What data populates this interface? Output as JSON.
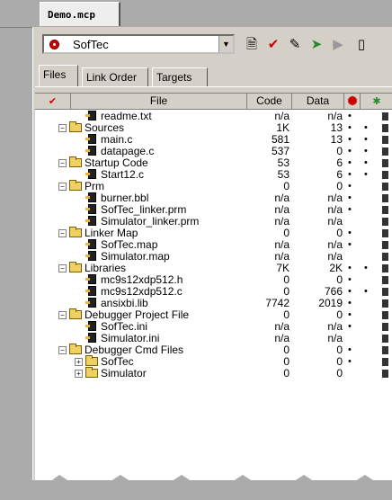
{
  "tab": {
    "label": "Demo.mcp"
  },
  "target": {
    "selected": "SofTec"
  },
  "subtabs": [
    "Files",
    "Link Order",
    "Targets"
  ],
  "columns": {
    "file": "File",
    "code": "Code",
    "data": "Data"
  },
  "rows": [
    {
      "name": "readme.txt",
      "code": "n/a",
      "data": "n/a",
      "depth": 1,
      "icon": "file",
      "b1": "•",
      "b2": ""
    },
    {
      "name": "Sources",
      "code": "1K",
      "data": "13",
      "depth": 0,
      "icon": "folder",
      "b1": "•",
      "b2": "•"
    },
    {
      "name": "main.c",
      "code": "581",
      "data": "13",
      "depth": 1,
      "icon": "file",
      "b1": "•",
      "b2": "•"
    },
    {
      "name": "datapage.c",
      "code": "537",
      "data": "0",
      "depth": 1,
      "icon": "file",
      "b1": "•",
      "b2": "•"
    },
    {
      "name": "Startup Code",
      "code": "53",
      "data": "6",
      "depth": 0,
      "icon": "folder",
      "b1": "•",
      "b2": "•"
    },
    {
      "name": "Start12.c",
      "code": "53",
      "data": "6",
      "depth": 1,
      "icon": "file",
      "b1": "•",
      "b2": "•"
    },
    {
      "name": "Prm",
      "code": "0",
      "data": "0",
      "depth": 0,
      "icon": "folder",
      "b1": "•",
      "b2": ""
    },
    {
      "name": "burner.bbl",
      "code": "n/a",
      "data": "n/a",
      "depth": 1,
      "icon": "file",
      "b1": "•",
      "b2": ""
    },
    {
      "name": "SofTec_linker.prm",
      "code": "n/a",
      "data": "n/a",
      "depth": 1,
      "icon": "file",
      "b1": "•",
      "b2": ""
    },
    {
      "name": "Simulator_linker.prm",
      "code": "n/a",
      "data": "n/a",
      "depth": 1,
      "icon": "file",
      "b1": "",
      "b2": ""
    },
    {
      "name": "Linker Map",
      "code": "0",
      "data": "0",
      "depth": 0,
      "icon": "folder",
      "b1": "•",
      "b2": ""
    },
    {
      "name": "SofTec.map",
      "code": "n/a",
      "data": "n/a",
      "depth": 1,
      "icon": "file",
      "b1": "•",
      "b2": ""
    },
    {
      "name": "Simulator.map",
      "code": "n/a",
      "data": "n/a",
      "depth": 1,
      "icon": "file",
      "b1": "",
      "b2": ""
    },
    {
      "name": "Libraries",
      "code": "7K",
      "data": "2K",
      "depth": 0,
      "icon": "folder",
      "b1": "•",
      "b2": "•"
    },
    {
      "name": "mc9s12xdp512.h",
      "code": "0",
      "data": "0",
      "depth": 1,
      "icon": "file",
      "b1": "•",
      "b2": ""
    },
    {
      "name": "mc9s12xdp512.c",
      "code": "0",
      "data": "766",
      "depth": 1,
      "icon": "file",
      "b1": "•",
      "b2": "•"
    },
    {
      "name": "ansixbi.lib",
      "code": "7742",
      "data": "2019",
      "depth": 1,
      "icon": "file",
      "b1": "•",
      "b2": ""
    },
    {
      "name": "Debugger Project File",
      "code": "0",
      "data": "0",
      "depth": 0,
      "icon": "folder",
      "b1": "•",
      "b2": ""
    },
    {
      "name": "SofTec.ini",
      "code": "n/a",
      "data": "n/a",
      "depth": 1,
      "icon": "file",
      "b1": "•",
      "b2": ""
    },
    {
      "name": "Simulator.ini",
      "code": "n/a",
      "data": "n/a",
      "depth": 1,
      "icon": "file",
      "b1": "",
      "b2": ""
    },
    {
      "name": "Debugger Cmd Files",
      "code": "0",
      "data": "0",
      "depth": 0,
      "icon": "folder",
      "b1": "•",
      "b2": ""
    },
    {
      "name": "SofTec",
      "code": "0",
      "data": "0",
      "depth": 1,
      "icon": "folder",
      "b1": "•",
      "b2": ""
    },
    {
      "name": "Simulator",
      "code": "0",
      "data": "0",
      "depth": 1,
      "icon": "folder",
      "b1": "",
      "b2": ""
    }
  ],
  "colors": {
    "accent_red": "#d00000",
    "folder": "#f0d060",
    "panel": "#d4d0c8"
  }
}
